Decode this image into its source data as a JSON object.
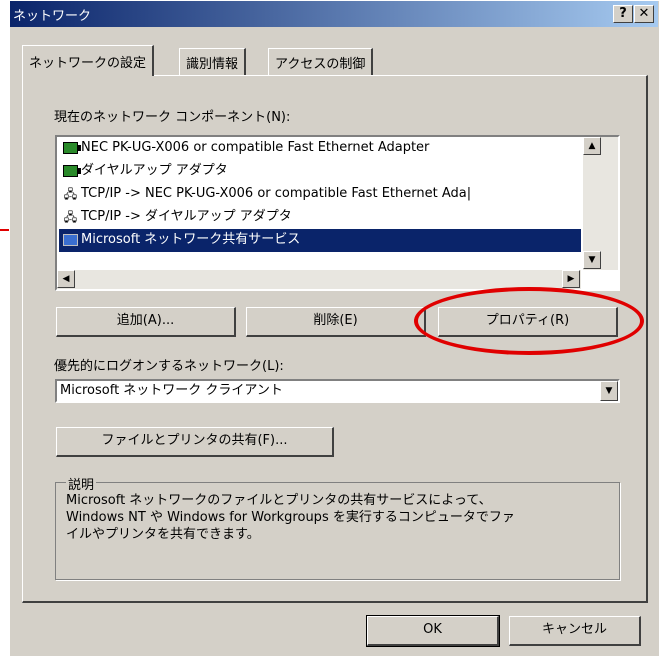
{
  "window": {
    "title": "ネットワーク"
  },
  "titlebar_buttons": {
    "help": "?",
    "close": "✕"
  },
  "tabs": [
    {
      "label": "ネットワークの設定",
      "active": true
    },
    {
      "label": "識別情報",
      "active": false
    },
    {
      "label": "アクセスの制御",
      "active": false
    }
  ],
  "components": {
    "label": "現在のネットワーク コンポーネント(N):",
    "items": [
      {
        "icon": "network-adapter-icon",
        "text": "NEC PK-UG-X006 or compatible Fast Ethernet Adapter"
      },
      {
        "icon": "network-adapter-icon",
        "text": "ダイヤルアップ アダプタ"
      },
      {
        "icon": "protocol-icon",
        "text": "TCP/IP -> NEC PK-UG-X006 or compatible Fast Ethernet Ada|"
      },
      {
        "icon": "protocol-icon",
        "text": "TCP/IP -> ダイヤルアップ アダプタ"
      },
      {
        "icon": "service-icon",
        "text": "Microsoft ネットワーク共有サービス",
        "selected": true
      }
    ]
  },
  "buttons": {
    "add": "追加(A)...",
    "remove": "削除(E)",
    "properties": "プロパティ(R)",
    "file_print_sharing": "ファイルとプリンタの共有(F)...",
    "ok": "OK",
    "cancel": "キャンセル"
  },
  "logon": {
    "label": "優先的にログオンするネットワーク(L):",
    "selected": "Microsoft ネットワーク クライアント"
  },
  "description": {
    "title": "説明",
    "text": "Microsoft ネットワークのファイルとプリンタの共有サービスによって、\nWindows NT や Windows for Workgroups を実行するコンピュータでファ\nイルやプリンタを共有できます。"
  },
  "colors": {
    "titlebar_start": "#0a246a",
    "titlebar_end": "#a6caf0",
    "selection": "#0a246a",
    "annotation": "#e00000"
  }
}
